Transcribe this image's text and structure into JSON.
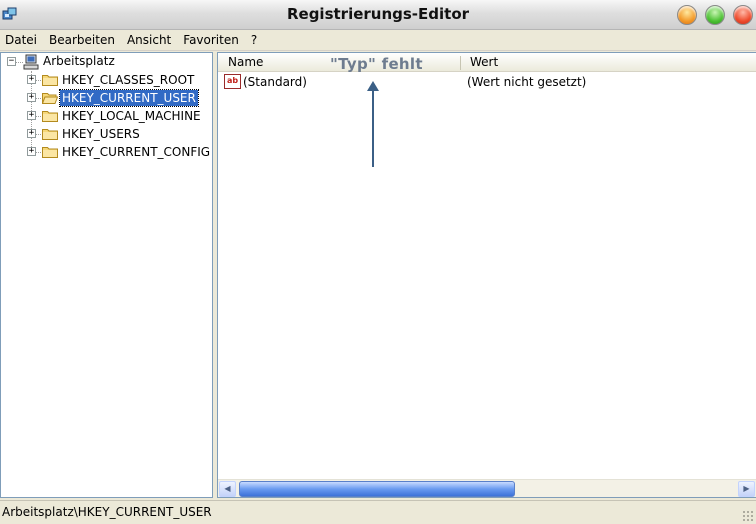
{
  "window": {
    "title": "Registrierungs-Editor",
    "app_icon": "regedit-icon"
  },
  "menu": [
    "Datei",
    "Bearbeiten",
    "Ansicht",
    "Favoriten",
    "?"
  ],
  "tree": {
    "root": {
      "label": "Arbeitsplatz",
      "icon": "computer-icon",
      "expanded": true
    },
    "children": [
      {
        "label": "HKEY_CLASSES_ROOT",
        "icon": "folder-icon",
        "selected": false
      },
      {
        "label": "HKEY_CURRENT_USER",
        "icon": "folder-open-icon",
        "selected": true
      },
      {
        "label": "HKEY_LOCAL_MACHINE",
        "icon": "folder-icon",
        "selected": false
      },
      {
        "label": "HKEY_USERS",
        "icon": "folder-icon",
        "selected": false
      },
      {
        "label": "HKEY_CURRENT_CONFIG",
        "icon": "folder-icon",
        "selected": false
      }
    ]
  },
  "list": {
    "columns": [
      "Name",
      "Wert"
    ],
    "annotation": "\"Typ\" fehlt",
    "rows": [
      {
        "icon": "string-value-icon",
        "icon_text": "ab",
        "name": "(Standard)",
        "value": "(Wert nicht gesetzt)"
      }
    ]
  },
  "status": {
    "path": "Arbeitsplatz\\HKEY_CURRENT_USER"
  },
  "colors": {
    "selection": "#316ac5",
    "annotation": "#6e7c8f",
    "arrow": "#3b5f86"
  }
}
